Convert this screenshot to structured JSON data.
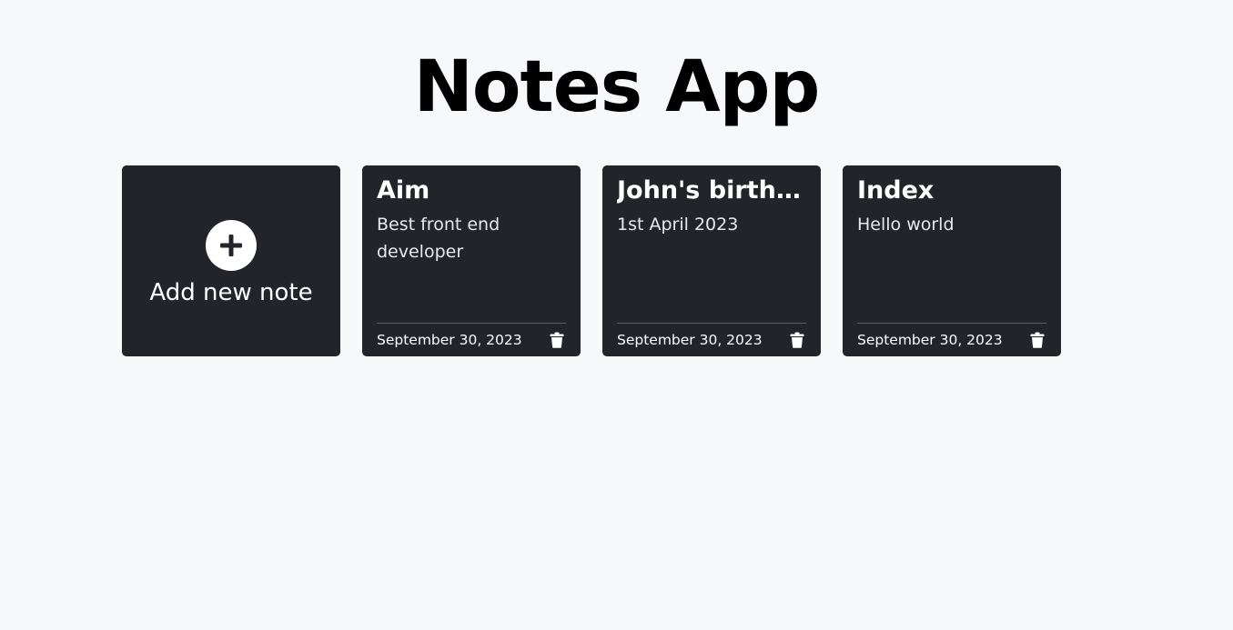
{
  "header": {
    "title": "Notes App"
  },
  "add_card": {
    "icon": "plus-icon",
    "label": "Add new note"
  },
  "notes": [
    {
      "title": "Aim",
      "description": "Best front end developer",
      "date": "September 30, 2023",
      "delete_icon": "trash-icon"
    },
    {
      "title": "John's birthday",
      "description": "1st April 2023",
      "date": "September 30, 2023",
      "delete_icon": "trash-icon"
    },
    {
      "title": "Index",
      "description": "Hello world",
      "date": "September 30, 2023",
      "delete_icon": "trash-icon"
    }
  ],
  "colors": {
    "background": "#f7f8fa",
    "card": "#22242a",
    "text_dark": "#000000",
    "text_light": "#ffffff"
  }
}
